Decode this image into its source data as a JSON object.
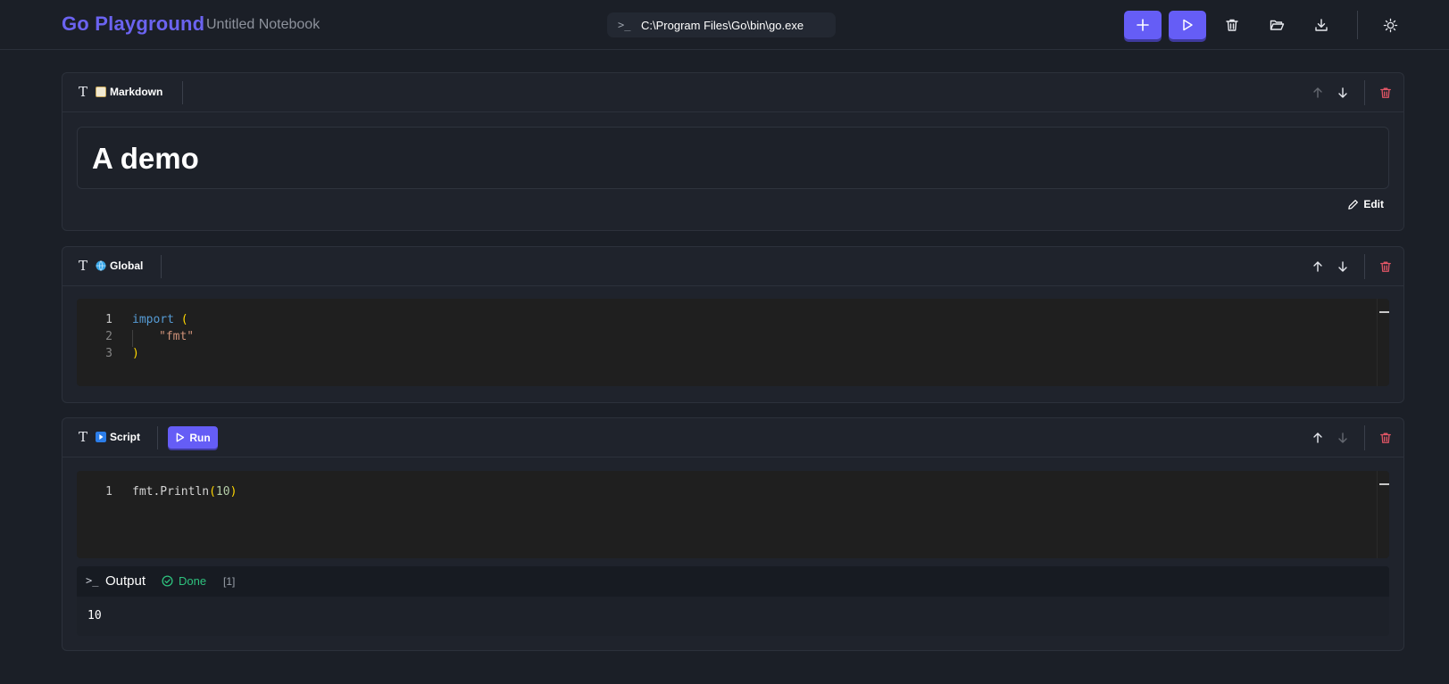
{
  "app": {
    "brand": "Go Playground",
    "notebook_title": "Untitled Notebook",
    "go_path": "C:\\Program Files\\Go\\bin\\go.exe"
  },
  "toolbar": {
    "buttons": [
      {
        "name": "add-cell-button",
        "icon": "plus-icon"
      },
      {
        "name": "run-all-button",
        "icon": "play-icon"
      },
      {
        "name": "clear-button",
        "icon": "trash-icon"
      },
      {
        "name": "open-button",
        "icon": "folder-open-icon"
      },
      {
        "name": "download-button",
        "icon": "download-icon"
      },
      {
        "name": "theme-toggle-button",
        "icon": "sun-icon"
      }
    ]
  },
  "cells": {
    "markdown": {
      "kind": "Markdown",
      "heading": "A demo",
      "edit_label": "Edit"
    },
    "global": {
      "kind": "Global",
      "lines": [
        {
          "num": "1",
          "text": "import ("
        },
        {
          "num": "2",
          "text": "\"fmt\""
        },
        {
          "num": "3",
          "text": ")"
        }
      ]
    },
    "script": {
      "kind": "Script",
      "run_label": "Run",
      "lines": [
        {
          "num": "1",
          "text": "fmt.Println(10)"
        }
      ],
      "output": {
        "title": "Output",
        "status": "Done",
        "count": "[1]",
        "text": "10"
      }
    }
  },
  "colors": {
    "accent": "#655df6",
    "background": "#1b1f27",
    "cell": "#1f232c",
    "delete": "#e05565",
    "success": "#2ec27e"
  }
}
